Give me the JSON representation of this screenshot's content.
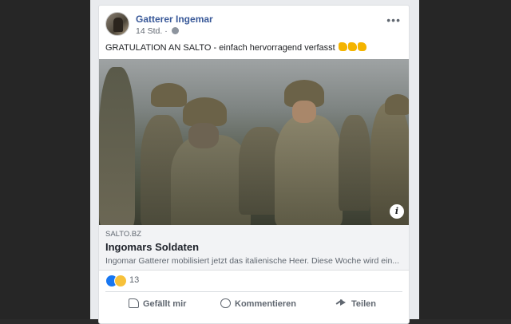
{
  "post": {
    "author": "Gatterer Ingemar",
    "time": "14 Std. ·",
    "more_glyph": "•••",
    "text": "GRATULATION AN SALTO - einfach hervorragend verfasst"
  },
  "link": {
    "domain": "SALTO.BZ",
    "title": "Ingomars Soldaten",
    "description": "Ingomar Gatterer mobilisiert jetzt das italienische Heer. Diese Woche wird ein..."
  },
  "reactions": {
    "count": "13"
  },
  "actions": {
    "like": "Gefällt mir",
    "comment": "Kommentieren",
    "share": "Teilen"
  },
  "icons": {
    "info": "i"
  }
}
